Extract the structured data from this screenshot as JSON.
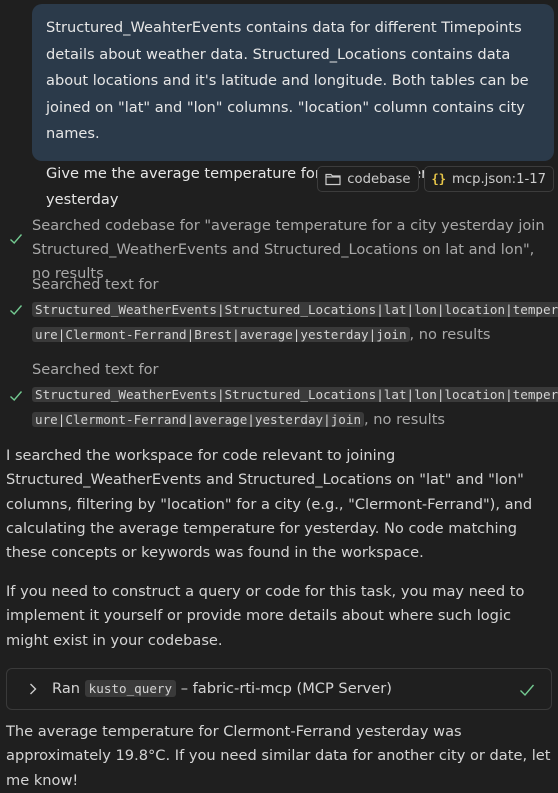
{
  "user_message": {
    "paragraph1": "Structured_WeahterEvents contains data for different Timepoints details about weather data. Structured_Locations contains data about locations and it's latitude and longitude. Both tables can be joined on \"lat\" and \"lon\" columns. \"location\" column contains city names.",
    "paragraph2": "Give me the average temperature for \"Clermont-Ferrand\" yesterday"
  },
  "references": [
    {
      "icon": "folder-icon",
      "label": "codebase"
    },
    {
      "icon": "braces-icon",
      "glyph": "{}",
      "label": "mcp.json:1-17"
    }
  ],
  "steps": [
    {
      "status": "done",
      "text": "Searched codebase for \"average temperature for a city yesterday join Structured_WeatherEvents and Structured_Locations on lat and lon\", no results"
    },
    {
      "status": "done",
      "prefix": "Searched text for",
      "code_line1": "Structured_WeatherEvents|Structured_Locations|lat|lon|location|temperat",
      "code_line2": "ure|Clermont-Ferrand|Brest|average|yesterday|join",
      "suffix": ", no results"
    },
    {
      "status": "done",
      "prefix": "Searched text for",
      "code_line1": "Structured_WeatherEvents|Structured_Locations|lat|lon|location|temperat",
      "code_line2": "ure|Clermont-Ferrand|average|yesterday|join",
      "suffix": ", no results"
    }
  ],
  "response": {
    "paragraph1": "I searched the workspace for code relevant to joining Structured_WeatherEvents and Structured_Locations on \"lat\" and \"lon\" columns, filtering by \"location\" for a city (e.g., \"Clermont-Ferrand\"), and calculating the average temperature for yesterday. No code matching these concepts or keywords was found in the workspace.",
    "paragraph2": "If you need to construct a query or code for this task, you may need to implement it yourself or provide more details about where such logic might exist in your codebase."
  },
  "tool_call": {
    "prefix": "Ran",
    "tool": "kusto_query",
    "suffix": " – fabric-rti-mcp (MCP Server)",
    "status": "done"
  },
  "final_answer": "The average temperature for Clermont-Ferrand yesterday was approximately 19.8°C. If you need similar data for another city or date, let me know!",
  "colors": {
    "background": "#1f1f1f",
    "user_bubble": "#2b3a4a",
    "check_green": "#73c991",
    "braces_yellow": "#e7c649"
  }
}
